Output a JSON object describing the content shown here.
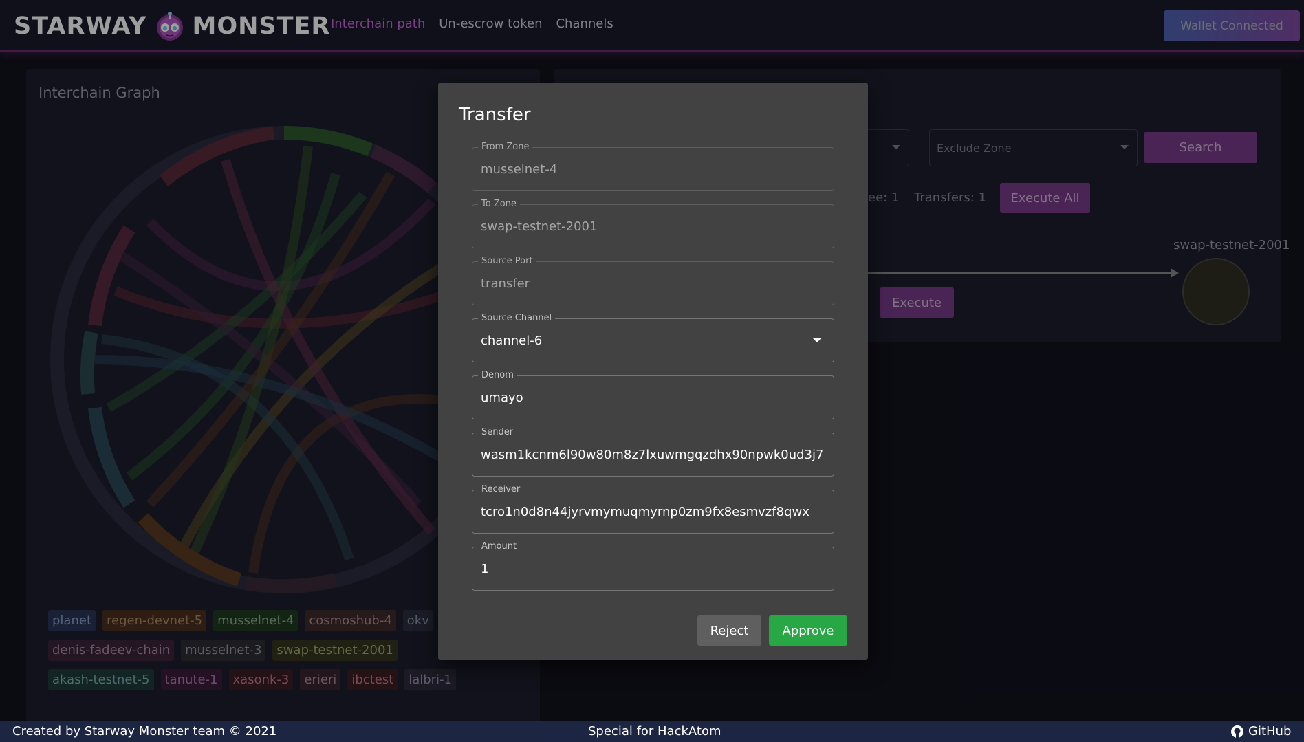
{
  "header": {
    "brand_left": "STARWAY",
    "brand_right": "MONSTER",
    "nav": [
      {
        "label": "Interchain path",
        "active": true
      },
      {
        "label": "Un-escrow token",
        "active": false
      },
      {
        "label": "Channels",
        "active": false
      }
    ],
    "wallet_button": "Wallet Connected"
  },
  "graph_panel": {
    "title": "Interchain Graph",
    "zone_tags": [
      [
        "planet",
        "regen-devnet-5",
        "musselnet-4",
        "cosmoshub-4",
        "okv"
      ],
      [
        "denis-fadeev-chain",
        "musselnet-3",
        "swap-testnet-2001"
      ],
      [
        "akash-testnet-5",
        "tanute-1",
        "xasonk-3",
        "erieri",
        "ibctest",
        "lalbri-1"
      ]
    ]
  },
  "search_panel": {
    "exclude_zone_placeholder": "Exclude Zone",
    "search_button": "Search",
    "fee_text": "ee: 1",
    "transfers_text": "Transfers: 1",
    "execute_all_button": "Execute All",
    "execute_button": "Execute",
    "target_node_label": "swap-testnet-2001"
  },
  "modal": {
    "title": "Transfer",
    "fields": [
      {
        "label": "From Zone",
        "value": "musselnet-4"
      },
      {
        "label": "To Zone",
        "value": "swap-testnet-2001"
      },
      {
        "label": "Source Port",
        "value": "transfer"
      },
      {
        "label": "Source Channel",
        "value": "channel-6"
      },
      {
        "label": "Denom",
        "value": "umayo"
      },
      {
        "label": "Sender",
        "value": "wasm1kcnm6l90w80m8z7lxuwmgqzdhx90npwk0ud3j7"
      },
      {
        "label": "Receiver",
        "value": "tcro1n0d8n44jyrvmymuqmyrnp0zm9fx8esmvzf8qwx"
      },
      {
        "label": "Amount",
        "value": "1"
      }
    ],
    "reject_button": "Reject",
    "approve_button": "Approve"
  },
  "footer": {
    "left": "Created by Starway Monster team © 2021",
    "center": "Special for HackAtom",
    "right": "GitHub"
  },
  "colors": {
    "accent": "#c866d8",
    "approve": "#28a745",
    "modal_bg": "#424242",
    "footer_bg": "#1c2542"
  }
}
